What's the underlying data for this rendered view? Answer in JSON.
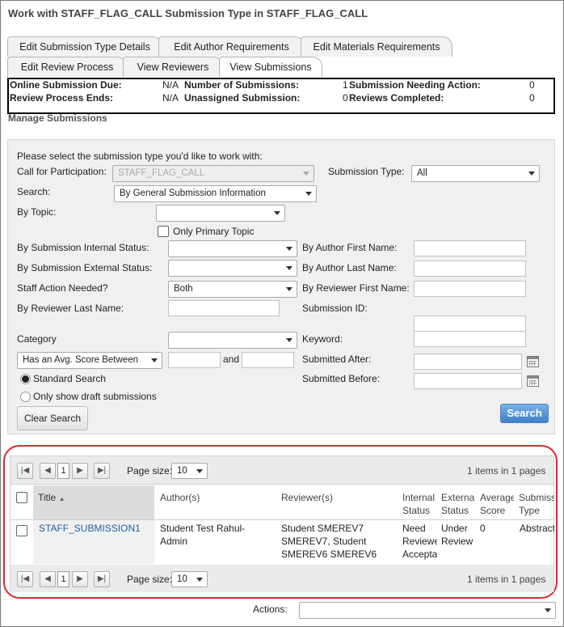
{
  "page_title": "Work with STAFF_FLAG_CALL Submission Type in STAFF_FLAG_CALL",
  "tabs_row1": [
    "Edit Submission Type Details",
    "Edit Author Requirements",
    "Edit Materials Requirements"
  ],
  "tabs_row2": [
    "Edit Review Process",
    "View Reviewers",
    "View Submissions"
  ],
  "summary": {
    "online_due_label": "Online Submission Due:",
    "online_due_value": "N/A",
    "review_ends_label": "Review Process Ends:",
    "review_ends_value": "N/A",
    "num_submissions_label": "Number of Submissions:",
    "num_submissions_value": "1",
    "unassigned_label": "Unassigned Submission:",
    "unassigned_value": "0",
    "needing_action_label": "Submission Needing Action:",
    "needing_action_value": "0",
    "reviews_completed_label": "Reviews Completed:",
    "reviews_completed_value": "0"
  },
  "manage_heading": "Manage Submissions",
  "form": {
    "intro": "Please select the submission type you'd like to work with:",
    "call_label": "Call for Participation:",
    "call_value": "STAFF_FLAG_CALL",
    "type_label": "Submission Type:",
    "type_value": "All",
    "search_label": "Search:",
    "search_value": "By General Submission Information",
    "topic_label": "By Topic:",
    "topic_value": "",
    "primary_topic_label": "Only Primary Topic",
    "internal_status_label": "By Submission Internal Status:",
    "external_status_label": "By Submission External Status:",
    "staff_action_label": "Staff Action Needed?",
    "staff_action_value": "Both",
    "reviewer_last_label": "By Reviewer Last Name:",
    "category_label": "Category",
    "score_select_value": "Has an Avg. Score Between",
    "and_label": "and",
    "author_first_label": "By Author First Name:",
    "author_last_label": "By Author Last Name:",
    "reviewer_first_label": "By Reviewer First Name:",
    "submission_id_label": "Submission ID:",
    "keyword_label": "Keyword:",
    "submitted_after_label": "Submitted After:",
    "submitted_before_label": "Submitted Before:",
    "standard_search_label": "Standard Search",
    "draft_label": "Only show draft submissions",
    "clear_button": "Clear Search",
    "search_button": "Search"
  },
  "pager": {
    "page": "1",
    "page_size_label": "Page size:",
    "page_size_value": "10",
    "summary": "1 items in 1 pages"
  },
  "columns": [
    "Title",
    "Author(s)",
    "Reviewer(s)",
    "Internal Status",
    "External Status",
    "Average Score",
    "Submission Type"
  ],
  "columns_lines": [
    [
      "Title"
    ],
    [
      "Author(s)"
    ],
    [
      "Reviewer(s)"
    ],
    [
      "Internal",
      "Status"
    ],
    [
      "External",
      "Status"
    ],
    [
      "Average",
      "Score"
    ],
    [
      "Submiss",
      "Type"
    ]
  ],
  "row": {
    "title": "STAFF_SUBMISSION1",
    "authors": [
      "Student Test Rahul-",
      "Admin"
    ],
    "reviewers": [
      "Student SMEREV7",
      "SMEREV7, Student",
      "SMEREV6 SMEREV6"
    ],
    "internal_status": [
      "Need",
      "Reviewe",
      "Accepta"
    ],
    "external_status": [
      "Under",
      "Review"
    ],
    "average_score": "0",
    "submission_type": "Abstract"
  },
  "actions_label": "Actions:",
  "colors": {
    "accent_blue": "#3f80c6",
    "highlight_red": "#e0262c",
    "link": "#1e5fae"
  }
}
